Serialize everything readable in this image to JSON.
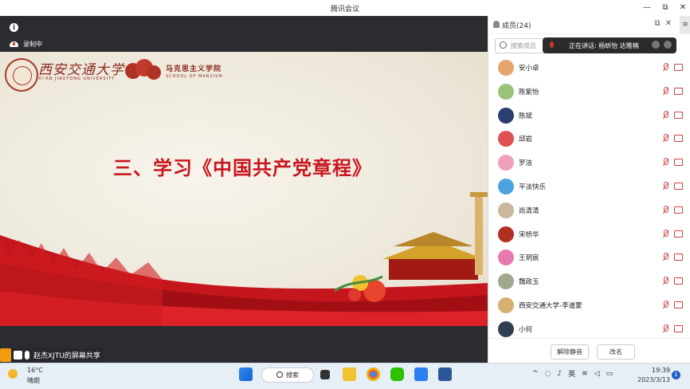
{
  "window": {
    "title": "腾讯会议",
    "minimize": "—",
    "restore": "⧉",
    "close": "✕"
  },
  "status": {
    "recording": "录制中",
    "info": "i"
  },
  "slide": {
    "university": "西安交通大学",
    "university_en": "XI'AN JIAOTONG UNIVERSITY",
    "school": "马克思主义学院",
    "school_en": "SCHOOL OF MARXISM",
    "title": "三、学习《中国共产党章程》"
  },
  "share": {
    "text": "赵杰XJTU的屏幕共享"
  },
  "members": {
    "title": "成员(24)",
    "menu": "≡",
    "search_placeholder": "搜索成员",
    "speaking": "正在讲话: 杨昕怡 达雅楠",
    "list": [
      {
        "name": "安小卓",
        "color": "#e8a46f"
      },
      {
        "name": "陈紫怡",
        "color": "#9bc37a"
      },
      {
        "name": "陈斌",
        "color": "#2c3e70"
      },
      {
        "name": "邱岩",
        "color": "#e05050"
      },
      {
        "name": "罗洁",
        "color": "#f0a0b8"
      },
      {
        "name": "平淡快乐",
        "color": "#4da3e0"
      },
      {
        "name": "尚清清",
        "color": "#c9b89c"
      },
      {
        "name": "宋桥华",
        "color": "#b03020"
      },
      {
        "name": "王玥宸",
        "color": "#e87ab0"
      },
      {
        "name": "魏政玉",
        "color": "#a0a890"
      },
      {
        "name": "西安交通大学-李道蒙",
        "color": "#d8b070"
      },
      {
        "name": "小何",
        "color": "#304050"
      }
    ],
    "unmute_all": "解除静音",
    "rename": "改名"
  },
  "taskbar": {
    "temp": "16°C",
    "weather": "晴朗",
    "search": "搜索",
    "ime": "英",
    "time": "19:39",
    "date": "2023/3/13",
    "notifications": "1"
  },
  "colors": {
    "accent": "#c8161d",
    "taskbar": "#e6eef6"
  }
}
